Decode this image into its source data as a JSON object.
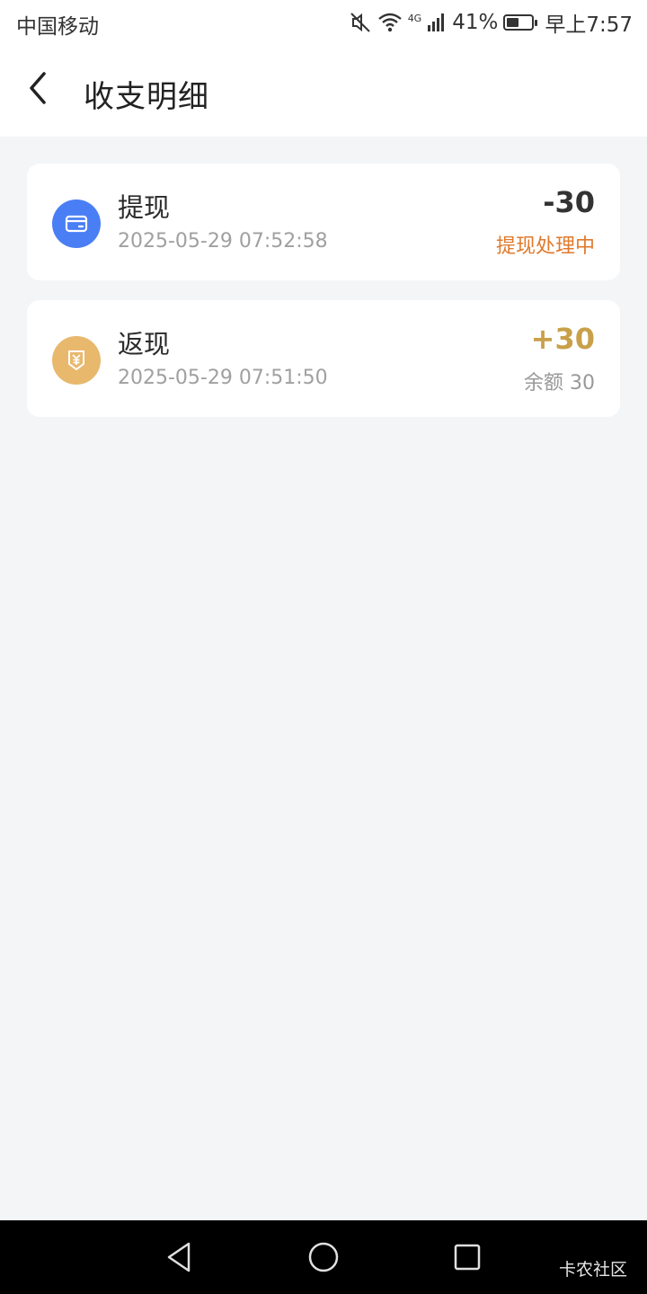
{
  "status_bar": {
    "carrier": "中国移动",
    "network": "4G",
    "battery": "41%",
    "time": "早上7:57",
    "icons": [
      "mute-icon",
      "wifi-icon",
      "signal-icon",
      "battery-icon"
    ]
  },
  "header": {
    "title": "收支明细",
    "back_icon": "back-icon"
  },
  "transactions": [
    {
      "title": "提现",
      "time": "2025-05-29 07:52:58",
      "amount": "-30",
      "subtext": "提现处理中",
      "icon": "wallet-icon",
      "icon_color": "#4a7ef5",
      "amount_color": "#333333",
      "subtext_color": "#e07a2c"
    },
    {
      "title": "返现",
      "time": "2025-05-29 07:51:50",
      "amount": "+30",
      "subtext": "余额 30",
      "icon": "yuan-icon",
      "icon_color": "#e8b86d",
      "amount_color": "#c9a04a",
      "subtext_color": "#999999"
    }
  ],
  "system_nav": {
    "buttons": [
      "back-triangle-icon",
      "home-circle-icon",
      "recents-square-icon"
    ],
    "watermark": "卡农社区"
  }
}
